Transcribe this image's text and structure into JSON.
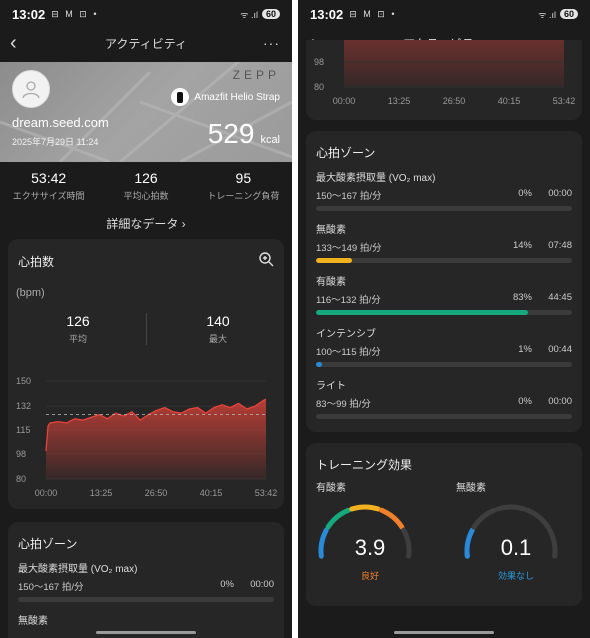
{
  "status": {
    "time": "13:02",
    "battery": "60",
    "icons": "⊟ M ⊡ •",
    "signal": "ᯤ .ıl"
  },
  "appbar": {
    "title": "アクティビティ",
    "back": "‹",
    "more": "···"
  },
  "hero": {
    "brand": "ZEPP",
    "device": "Amazfit Helio Strap",
    "user": "dream.seed.com",
    "date": "2025年7月29日 11:24",
    "calories": "529",
    "calories_unit": "kcal"
  },
  "stats": [
    {
      "value": "53:42",
      "label": "エクササイズ時間"
    },
    {
      "value": "126",
      "label": "平均心拍数"
    },
    {
      "value": "95",
      "label": "トレーニング負荷"
    }
  ],
  "detail_link": "詳細なデータ ›",
  "heart_rate": {
    "title": "心拍数",
    "unit": "(bpm)",
    "avg_value": "126",
    "avg_label": "平均",
    "max_value": "140",
    "max_label": "最大"
  },
  "chart_data": {
    "type": "area",
    "xlabel": "",
    "ylabel": "",
    "x_ticks": [
      "00:00",
      "13:25",
      "26:50",
      "40:15",
      "53:42"
    ],
    "y_ticks": [
      150,
      132,
      115,
      98,
      80
    ],
    "ylim": [
      80,
      150
    ],
    "avg_line": 126,
    "series": [
      {
        "name": "",
        "x_minutes": [
          0,
          0.5,
          1,
          3,
          5,
          7,
          9,
          11,
          13,
          15,
          17,
          19,
          21,
          23,
          25,
          27,
          29,
          31,
          33,
          35,
          37,
          39,
          41,
          43,
          45,
          47,
          49,
          51,
          53,
          53.7
        ],
        "values": [
          100,
          118,
          120,
          121,
          120,
          123,
          122,
          124,
          126,
          123,
          127,
          125,
          128,
          122,
          126,
          129,
          131,
          128,
          127,
          130,
          131,
          127,
          131,
          133,
          131,
          134,
          130,
          132,
          136,
          137
        ]
      }
    ],
    "color": "#e8443a"
  },
  "top_chart": {
    "y_ticks": [
      98,
      80
    ],
    "x_ticks": [
      "00:00",
      "13:25",
      "26:50",
      "40:15",
      "53:42"
    ]
  },
  "zones": {
    "title": "心拍ゾーン",
    "items": [
      {
        "name": "最大酸素摂取量 (VO₂ max)",
        "range": "150〜167 拍/分",
        "pct": "0%",
        "dur": "00:00",
        "fraction": 0,
        "color": "#d04a3a"
      },
      {
        "name": "無酸素",
        "range": "133〜149 拍/分",
        "pct": "14%",
        "dur": "07:48",
        "fraction": 0.14,
        "color": "#f2b21f"
      },
      {
        "name": "有酸素",
        "range": "116〜132 拍/分",
        "pct": "83%",
        "dur": "44:45",
        "fraction": 0.83,
        "color": "#15a97d"
      },
      {
        "name": "インテンシブ",
        "range": "100〜115 拍/分",
        "pct": "1%",
        "dur": "00:44",
        "fraction": 0.01,
        "color": "#2a8ad8"
      },
      {
        "name": "ライト",
        "range": "83〜99 拍/分",
        "pct": "0%",
        "dur": "00:00",
        "fraction": 0,
        "color": "#888888"
      }
    ]
  },
  "training_effect": {
    "title": "トレーニング効果",
    "aerobic": {
      "label": "有酸素",
      "value": "3.9",
      "status": "良好",
      "status_color": "#f0802c",
      "fraction": 0.78
    },
    "anaerobic": {
      "label": "無酸素",
      "value": "0.1",
      "status": "効果なし",
      "status_color": "#2a9ad8",
      "fraction": 0.02
    }
  },
  "colors": {
    "accent_red": "#e8443a",
    "zone_blue": "#2a8ad8",
    "zone_green": "#15a97d",
    "zone_yellow": "#f2b21f",
    "zone_orange": "#f0802c"
  }
}
